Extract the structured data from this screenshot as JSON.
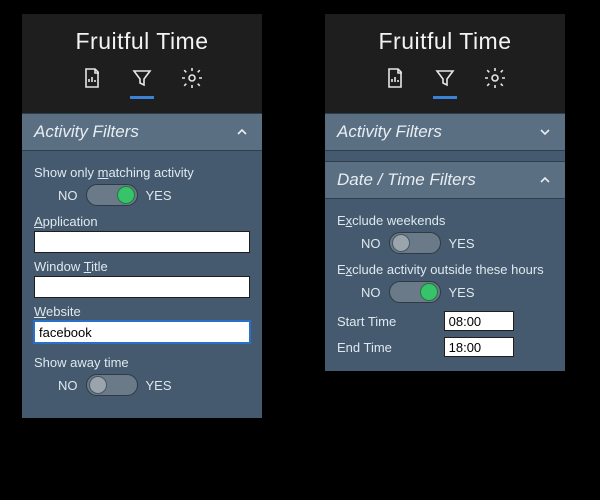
{
  "app_title": "Fruitful Time",
  "tabs": {
    "report": "report",
    "filter": "filter",
    "settings": "settings"
  },
  "left": {
    "activity_filters": {
      "title": "Activity Filters",
      "expanded": true,
      "show_matching_label": "Show only matching activity",
      "show_matching_on": true,
      "no": "NO",
      "yes": "YES",
      "application_label": "Application",
      "application_value": "",
      "window_title_label": "Window Title",
      "window_title_value": "",
      "website_label": "Website",
      "website_value": "facebook",
      "show_away_label": "Show away time",
      "show_away_on": false
    }
  },
  "right": {
    "activity_filters": {
      "title": "Activity Filters",
      "expanded": false
    },
    "datetime_filters": {
      "title": "Date / Time Filters",
      "expanded": true,
      "exclude_weekends_label": "Exclude weekends",
      "exclude_weekends_on": false,
      "exclude_hours_label": "Exclude activity outside these hours",
      "exclude_hours_on": true,
      "no": "NO",
      "yes": "YES",
      "start_label": "Start Time",
      "start_value": "08:00",
      "end_label": "End Time",
      "end_value": "18:00"
    }
  }
}
